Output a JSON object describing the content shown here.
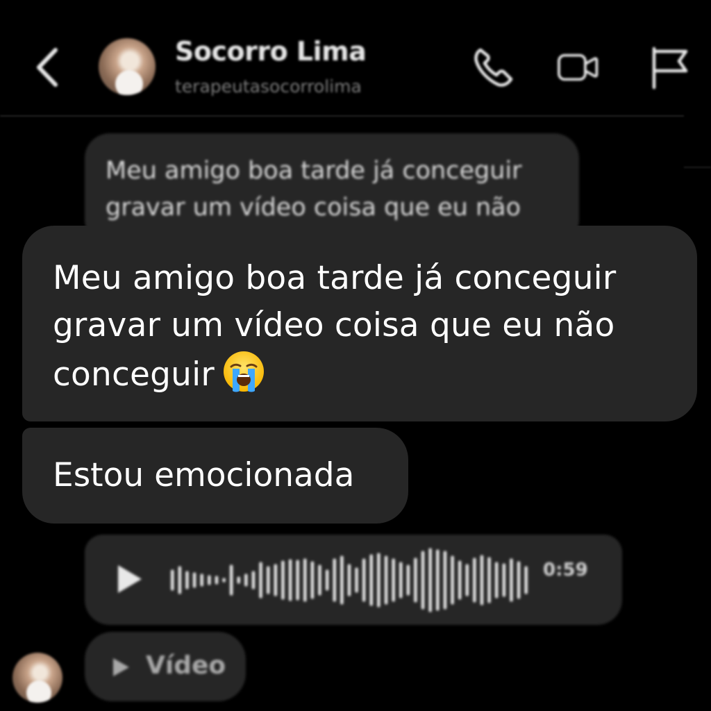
{
  "header": {
    "contact_name": "Socorro Lima",
    "contact_handle": "terapeutasocorrolima",
    "icons": [
      "back-arrow-icon",
      "phone-icon",
      "video-camera-icon",
      "flag-icon"
    ]
  },
  "messages": {
    "top_preview": {
      "line1": "Meu amigo boa tarde já conceguir",
      "line2": "gravar um vídeo coisa que eu não"
    },
    "message1": {
      "line1": "Meu amigo boa tarde já conceguir",
      "line2": "gravar um vídeo coisa que eu não",
      "line3": "conceguir",
      "emoji": "loudly-crying-face-emoji"
    },
    "message2": {
      "text": "Estou emocionada"
    },
    "audio": {
      "duration": "0:59"
    },
    "video": {
      "label": "Vídeo"
    }
  },
  "colors": {
    "background": "#000000",
    "bubble": "#262626",
    "text": "#ffffff",
    "muted": "#7c7c7c"
  }
}
